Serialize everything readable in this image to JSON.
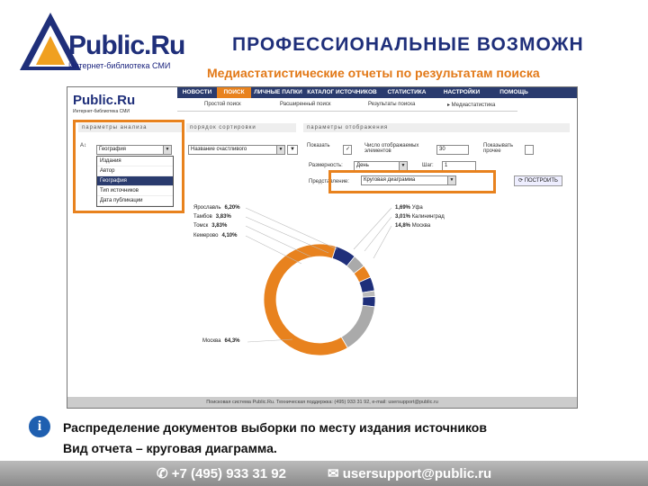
{
  "header": {
    "logo_text": "Public.Ru",
    "logo_sub": "Интернет-библиотека СМИ",
    "title": "ПРОФЕССИОНАЛЬНЫЕ ВОЗМОЖН",
    "subtitle": "Медиастатистические отчеты по результатам поиска"
  },
  "screenshot": {
    "nav": [
      "НОВОСТИ",
      "ПОИСК",
      "ЛИЧНЫЕ ПАПКИ",
      "КАТАЛОГ ИСТОЧНИКОВ",
      "СТАТИСТИКА",
      "НАСТРОЙКИ",
      "ПОМОЩЬ"
    ],
    "subnav": [
      "Простой поиск",
      "Расширенный поиск",
      "Результаты поиска",
      "▸ Медиастатистика"
    ],
    "params_header": "параметры анализа",
    "sort_header": "порядок сортировки",
    "display_header": "параметры отображения",
    "analysis_select": "География",
    "analysis_options": [
      "Издания",
      "Автор",
      "География",
      "Тип источников",
      "Дата публикации"
    ],
    "sort_select": "Название счастливого",
    "show_label": "Показать",
    "count_label": "Число отображаемых элементов",
    "count_value": "30",
    "show_other_label": "Показывать прочее",
    "dimension_label": "Размерность:",
    "dimension_value": "День",
    "step_label": "Шаг:",
    "step_value": "1",
    "view_label": "Представление:",
    "view_value": "Круговая диаграмма",
    "build_button": "ПОСТРОИТЬ",
    "legend_left": [
      {
        "name": "Ярославль",
        "value": "6,20%"
      },
      {
        "name": "Тамбов",
        "value": "3,83%"
      },
      {
        "name": "Томск",
        "value": "3,83%"
      },
      {
        "name": "Кемерово",
        "value": "4,10%"
      }
    ],
    "legend_right": [
      {
        "name": "Уфа",
        "value": "1,69%"
      },
      {
        "name": "Калининград",
        "value": "3,01%"
      },
      {
        "name": "Москва",
        "value": "14,8%"
      }
    ],
    "legend_bottom": {
      "name": "Москва",
      "value": "64,3%"
    },
    "footer": "Поисковая система Public.Ru. Техническая поддержка: (495) 933 31 92, e-mail: usersupport@public.ru"
  },
  "caption": {
    "line1": "Распределение документов выборки по месту издания источников",
    "line2": "Вид отчета – круговая диаграмма."
  },
  "contacts": {
    "phone": "+7 (495) 933 31 92",
    "email": "usersupport@public.ru"
  },
  "colors": {
    "accent": "#e8821e",
    "brand": "#1f2f7a"
  }
}
